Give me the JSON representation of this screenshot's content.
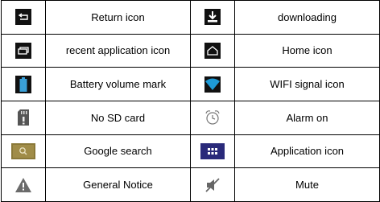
{
  "rows": [
    {
      "left": {
        "icon": "return-icon",
        "label": "Return icon"
      },
      "right": {
        "icon": "download-icon",
        "label": "downloading"
      }
    },
    {
      "left": {
        "icon": "recent-apps-icon",
        "label": "recent application icon"
      },
      "right": {
        "icon": "home-icon",
        "label": "Home icon"
      }
    },
    {
      "left": {
        "icon": "battery-icon",
        "label": "Battery volume mark"
      },
      "right": {
        "icon": "wifi-signal-icon",
        "label": "WIFI signal icon"
      }
    },
    {
      "left": {
        "icon": "no-sd-card-icon",
        "label": "No SD card"
      },
      "right": {
        "icon": "alarm-clock-icon",
        "label": "Alarm on"
      }
    },
    {
      "left": {
        "icon": "google-search-icon",
        "label": "Google search"
      },
      "right": {
        "icon": "app-grid-icon",
        "label": "Application icon"
      }
    },
    {
      "left": {
        "icon": "warning-triangle-icon",
        "label": "General Notice"
      },
      "right": {
        "icon": "mute-speaker-icon",
        "label": "Mute"
      }
    }
  ],
  "colors": {
    "icon_dark": "#111111",
    "wifi_accent": "#1e9bd7",
    "battery_accent": "#3aa0d8",
    "google_tile": "#8a7838",
    "app_tile": "#2a2a7a",
    "grey_icon": "#666666"
  }
}
